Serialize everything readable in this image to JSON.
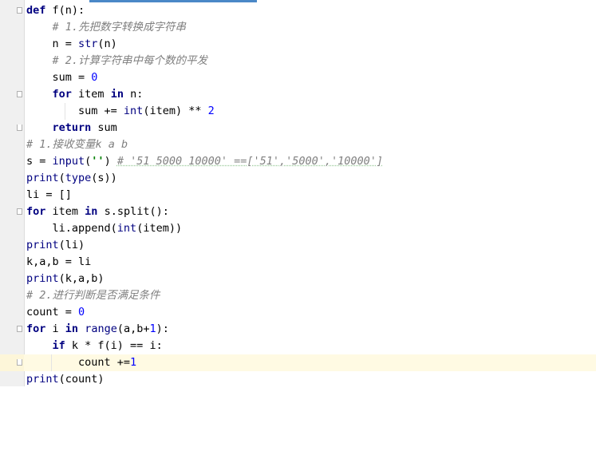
{
  "lines": [
    "def f(n):",
    "    # 1.先把数字转换成字符串",
    "    n = str(n)",
    "    # 2.计算字符串中每个数的平发",
    "    sum = 0",
    "    for item in n:",
    "        sum += int(item) ** 2",
    "    return sum",
    "# 1.接收变量k a b",
    "s = input('') # '51 5000 10000' ==['51','5000','10000']",
    "print(type(s))",
    "li = []",
    "for item in s.split():",
    "    li.append(int(item))",
    "print(li)",
    "k,a,b = li",
    "print(k,a,b)",
    "# 2.进行判断是否满足条件",
    "count = 0",
    "for i in range(a,b+1):",
    "    if k * f(i) == i:",
    "        count +=1",
    "print(count)"
  ],
  "colors": {
    "keyword": "#000080",
    "number": "#0000ff",
    "string": "#008000",
    "comment": "#808080",
    "current_line": "#fffae3",
    "gutter": "#f0f0f0"
  },
  "current_line_index": 21
}
